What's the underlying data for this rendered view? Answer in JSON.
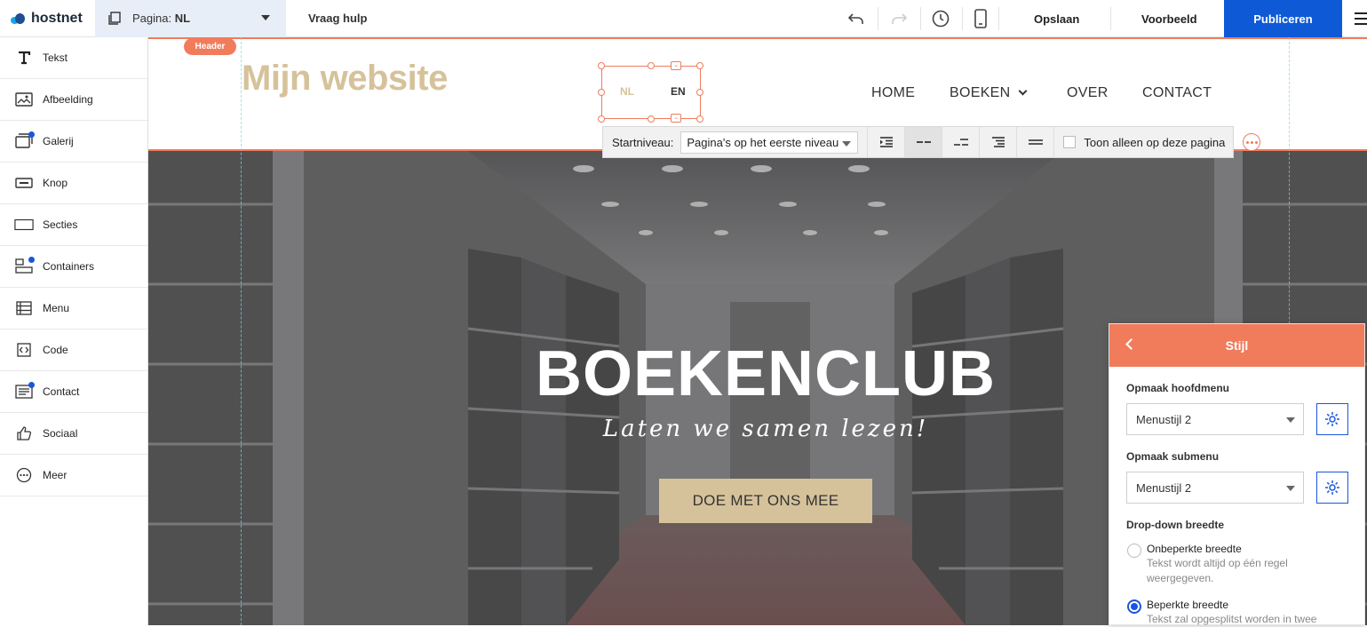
{
  "topbar": {
    "logo": "hostnet",
    "page_prefix": "Pagina:",
    "page_value": "NL",
    "help": "Vraag hulp",
    "save": "Opslaan",
    "preview": "Voorbeeld",
    "publish": "Publiceren"
  },
  "sidebar": {
    "items": [
      {
        "label": "Tekst",
        "icon": "text-icon"
      },
      {
        "label": "Afbeelding",
        "icon": "image-icon"
      },
      {
        "label": "Galerij",
        "icon": "gallery-icon"
      },
      {
        "label": "Knop",
        "icon": "button-icon"
      },
      {
        "label": "Secties",
        "icon": "section-icon"
      },
      {
        "label": "Containers",
        "icon": "containers-icon"
      },
      {
        "label": "Menu",
        "icon": "menu-icon"
      },
      {
        "label": "Code",
        "icon": "code-icon"
      },
      {
        "label": "Contact",
        "icon": "contact-icon"
      },
      {
        "label": "Sociaal",
        "icon": "thumbs-up-icon"
      },
      {
        "label": "Meer",
        "icon": "more-icon"
      }
    ]
  },
  "header": {
    "badge": "Header",
    "site_title": "Mijn website",
    "lang_nl": "NL",
    "lang_en": "EN",
    "nav": [
      "HOME",
      "BOEKEN",
      "OVER",
      "CONTACT"
    ]
  },
  "toolbar": {
    "start_label": "Startniveau:",
    "start_value": "Pagina's op het eerste niveau",
    "only_page_label": "Toon alleen op deze pagina"
  },
  "hero": {
    "title": "BOEKENCLUB",
    "subtitle": "Laten we samen lezen!",
    "button": "DOE MET ONS MEE"
  },
  "panel": {
    "title": "Stijl",
    "main_label": "Opmaak hoofdmenu",
    "main_value": "Menustijl 2",
    "sub_label": "Opmaak submenu",
    "sub_value": "Menustijl 2",
    "dropdown_label": "Drop-down breedte",
    "opt1_label": "Onbeperkte breedte",
    "opt1_desc": "Tekst wordt altijd op één regel weergegeven.",
    "opt2_label": "Beperkte breedte",
    "opt2_desc": "Tekst zal opgesplitst worden in twee"
  },
  "colors": {
    "accent": "#f07c5c",
    "brand_blue": "#0e5ad6",
    "title_gold": "#d6c29a"
  }
}
